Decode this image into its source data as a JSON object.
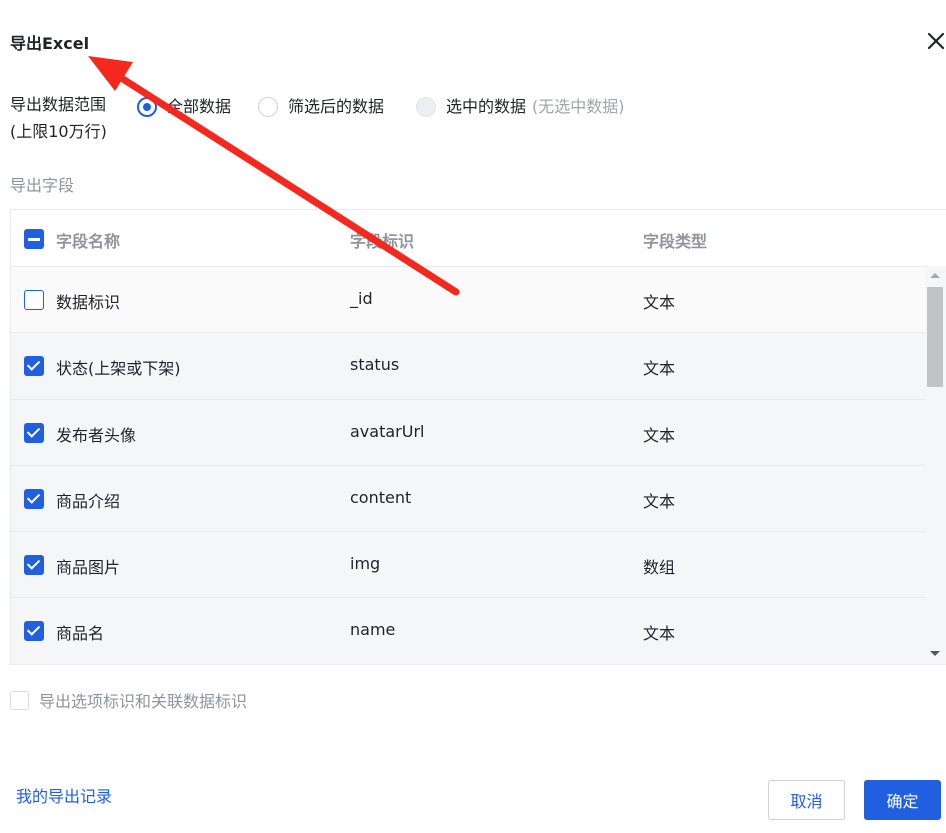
{
  "dialog": {
    "title": "导出Excel"
  },
  "range": {
    "label": "导出数据范围",
    "limit": "(上限10万行)",
    "options": [
      {
        "label": "全部数据",
        "checked": true,
        "disabled": false,
        "hint": ""
      },
      {
        "label": "筛选后的数据",
        "checked": false,
        "disabled": false,
        "hint": ""
      },
      {
        "label": "选中的数据",
        "checked": false,
        "disabled": true,
        "hint": "(无选中数据)"
      }
    ]
  },
  "fields": {
    "label": "导出字段",
    "headers": {
      "name": "字段名称",
      "id": "字段标识",
      "type": "字段类型"
    },
    "rows": [
      {
        "name": "数据标识",
        "id": "_id",
        "type": "文本",
        "checked": false
      },
      {
        "name": "状态(上架或下架)",
        "id": "status",
        "type": "文本",
        "checked": true
      },
      {
        "name": "发布者头像",
        "id": "avatarUrl",
        "type": "文本",
        "checked": true
      },
      {
        "name": "商品介绍",
        "id": "content",
        "type": "文本",
        "checked": true
      },
      {
        "name": "商品图片",
        "id": "img",
        "type": "数组",
        "checked": true
      },
      {
        "name": "商品名",
        "id": "name",
        "type": "文本",
        "checked": true
      }
    ]
  },
  "option": {
    "label": "导出选项标识和关联数据标识"
  },
  "footer": {
    "history_link": "我的导出记录",
    "cancel_label": "取消",
    "confirm_label": "确定"
  },
  "colors": {
    "primary": "#1f5fe0",
    "annotation_arrow": "#f5281e"
  }
}
